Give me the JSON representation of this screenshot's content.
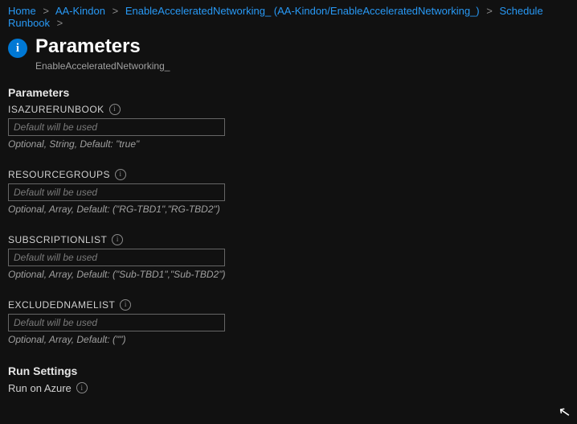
{
  "breadcrumb": {
    "items": [
      {
        "label": "Home"
      },
      {
        "label": "AA-Kindon"
      },
      {
        "label": "EnableAcceleratedNetworking_ (AA-Kindon/EnableAcceleratedNetworking_)"
      },
      {
        "label": "Schedule Runbook"
      }
    ],
    "separator": ">"
  },
  "header": {
    "icon_letter": "i",
    "title": "Parameters",
    "subtitle": "EnableAcceleratedNetworking_"
  },
  "sections": {
    "parameters_heading": "Parameters",
    "run_settings_heading": "Run Settings",
    "run_on_label": "Run on Azure"
  },
  "info_glyph": "i",
  "params": [
    {
      "label": "ISAZURERUNBOOK",
      "placeholder": "Default will be used",
      "help": "Optional, String, Default: \"true\""
    },
    {
      "label": "RESOURCEGROUPS",
      "placeholder": "Default will be used",
      "help": "Optional, Array, Default: (\"RG-TBD1\",\"RG-TBD2\")"
    },
    {
      "label": "SUBSCRIPTIONLIST",
      "placeholder": "Default will be used",
      "help": "Optional, Array, Default: (\"Sub-TBD1\",\"Sub-TBD2\")"
    },
    {
      "label": "EXCLUDEDNAMELIST",
      "placeholder": "Default will be used",
      "help": "Optional, Array, Default: (\"\")"
    }
  ]
}
